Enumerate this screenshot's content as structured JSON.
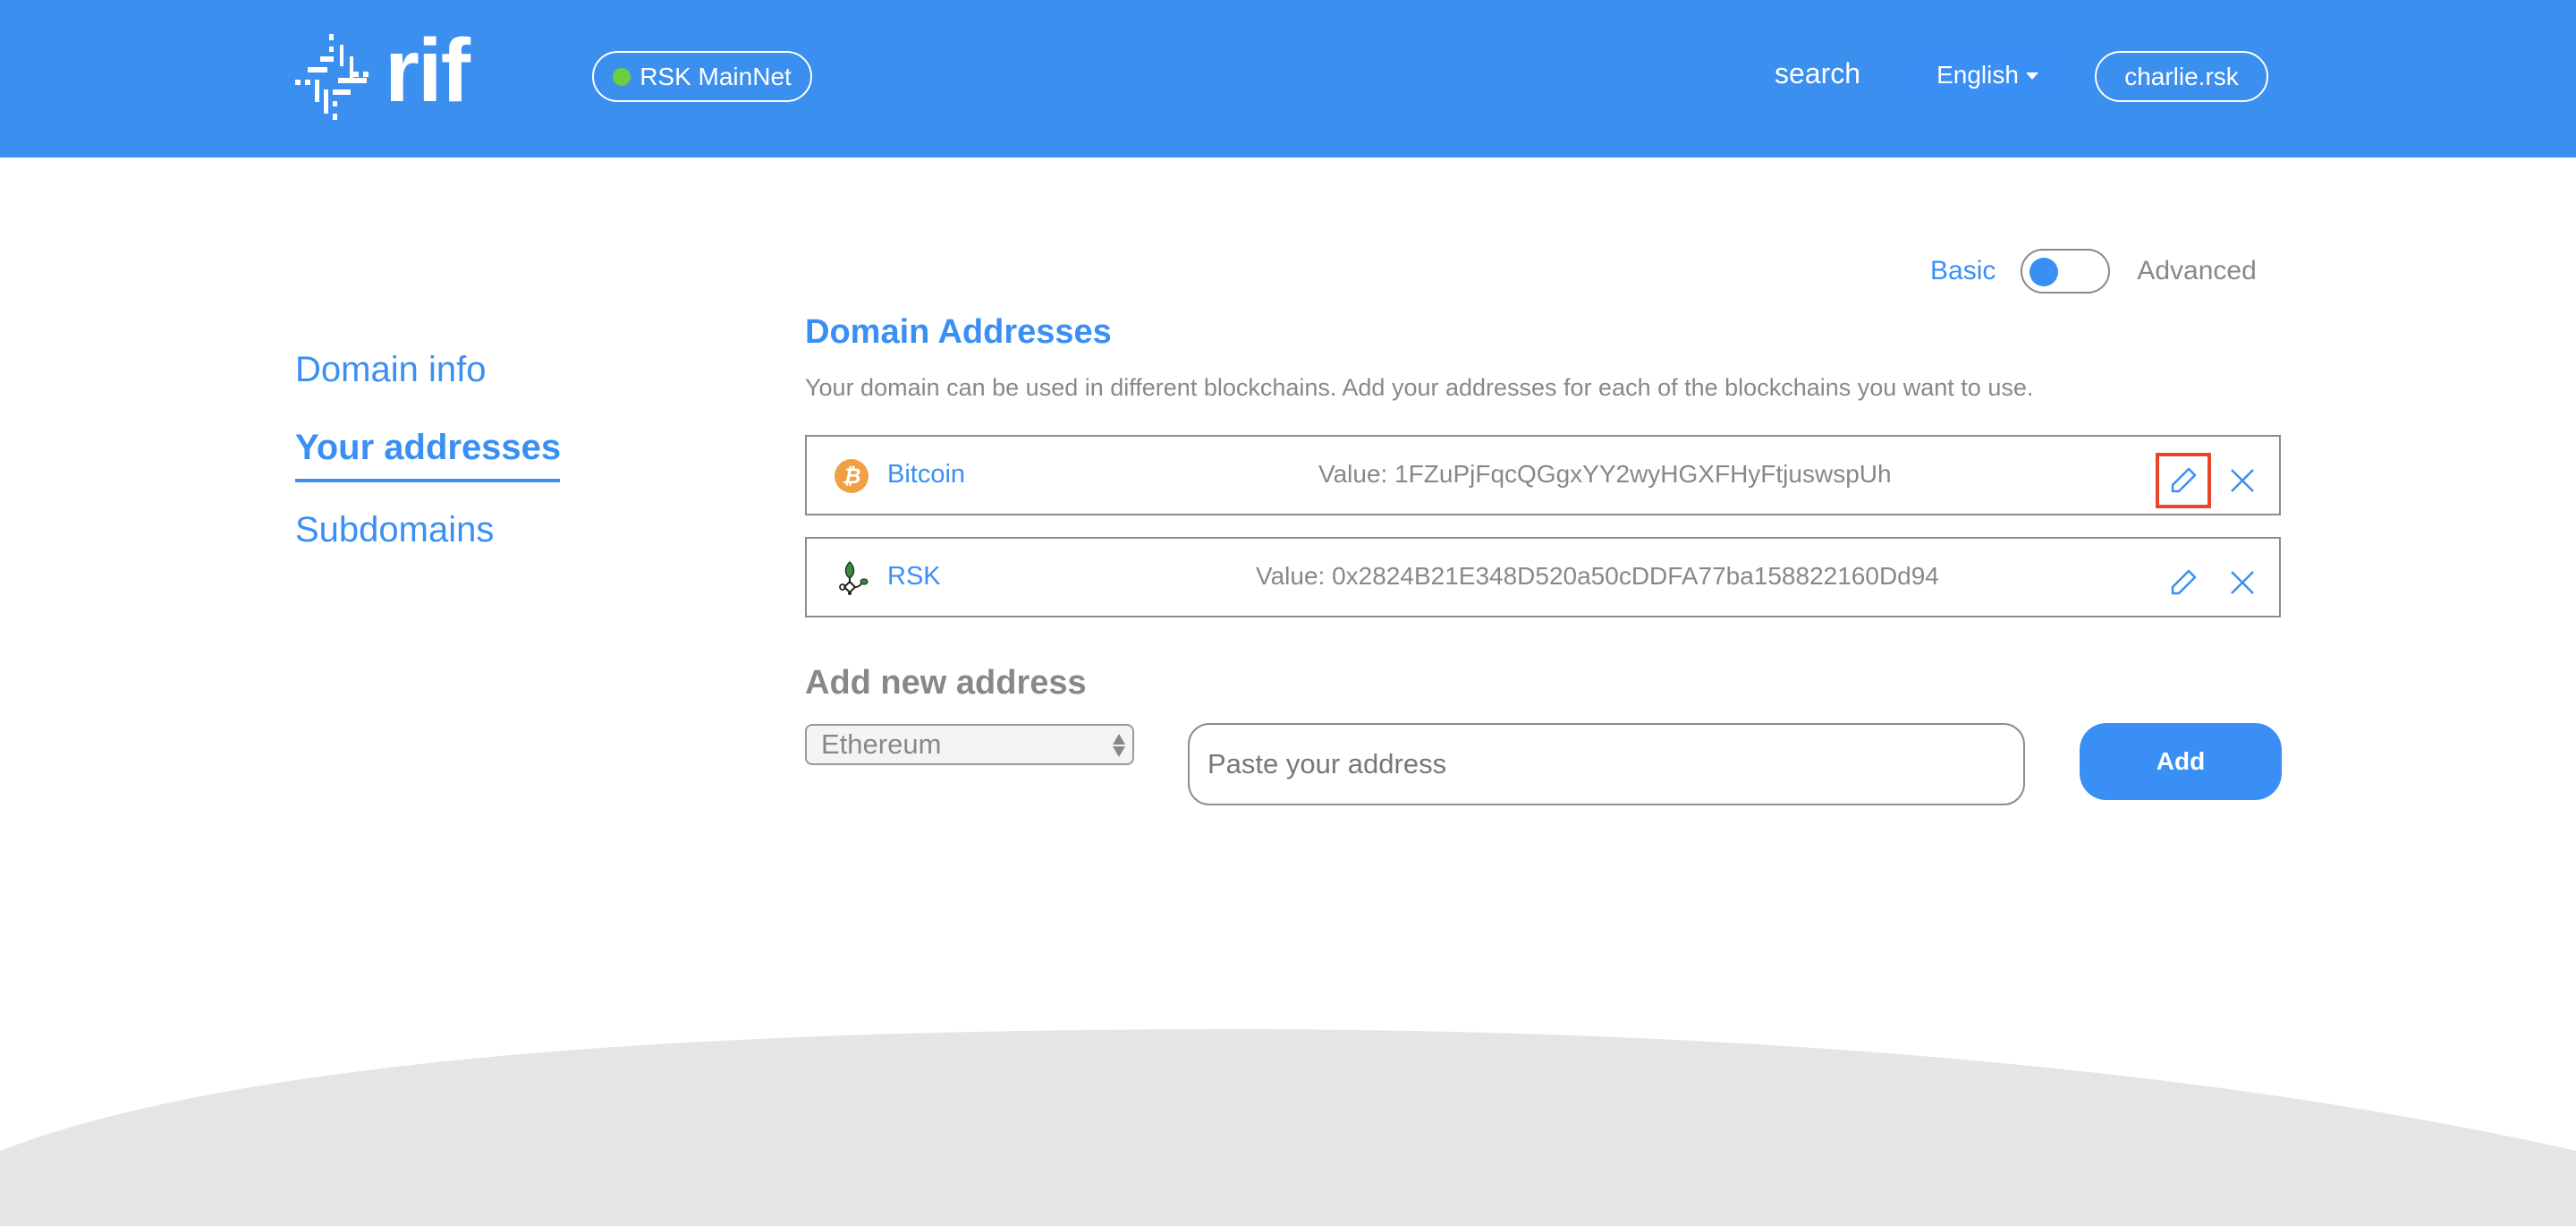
{
  "header": {
    "logo_text": "rif",
    "network": {
      "label": "RSK MainNet",
      "status_color": "#6cce3c"
    },
    "search_label": "search",
    "language": "English",
    "user": "charlie.rsk"
  },
  "colors": {
    "brand": "#3a8fef",
    "accent": "#3a8ff5",
    "muted": "#888888",
    "highlight": "#e8452c",
    "footer": "#e5e5e5"
  },
  "mode_toggle": {
    "basic_label": "Basic",
    "advanced_label": "Advanced",
    "selected": "Basic"
  },
  "sidebar": {
    "items": [
      {
        "label": "Domain info",
        "active": false
      },
      {
        "label": "Your addresses",
        "active": true
      },
      {
        "label": "Subdomains",
        "active": false
      }
    ]
  },
  "main": {
    "title": "Domain Addresses",
    "description": "Your domain can be used in different blockchains. Add your addresses for each of the blockchains you want to use.",
    "addresses": [
      {
        "chain": "Bitcoin",
        "icon": "bitcoin-icon",
        "value": "Value: 1FZuPjFqcQGgxYY2wyHGXFHyFtjuswspUh",
        "edit_icon": "pencil-icon",
        "delete_icon": "close-icon"
      },
      {
        "chain": "RSK",
        "icon": "rsk-icon",
        "value": "Value: 0x2824B21E348D520a50cDDFA77ba158822160Dd94",
        "edit_icon": "pencil-icon",
        "delete_icon": "close-icon"
      }
    ],
    "add_new": {
      "title": "Add new address",
      "selected_chain": "Ethereum",
      "input_placeholder": "Paste your address",
      "input_value": "",
      "button_label": "Add"
    }
  }
}
